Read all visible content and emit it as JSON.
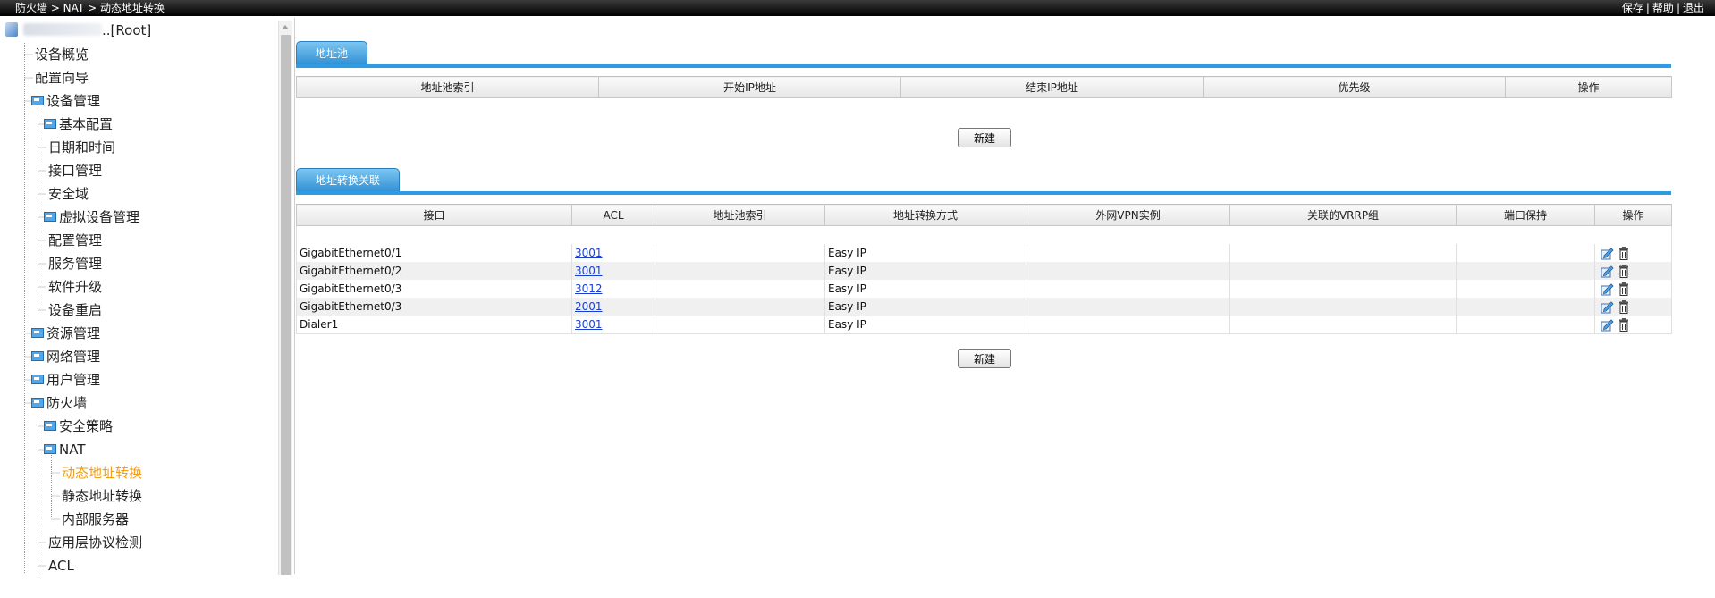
{
  "topbar": {
    "breadcrumb": "防火墙 > NAT > 动态地址转换",
    "save": "保存",
    "sep1": "|",
    "help": "帮助",
    "sep2": "|",
    "logout": "退出"
  },
  "sidebar": {
    "root_label": "..[Root]",
    "items": [
      {
        "label": "设备概览"
      },
      {
        "label": "配置向导"
      },
      {
        "label": "设备管理"
      },
      {
        "label": "基本配置"
      },
      {
        "label": "日期和时间"
      },
      {
        "label": "接口管理"
      },
      {
        "label": "安全域"
      },
      {
        "label": "虚拟设备管理"
      },
      {
        "label": "配置管理"
      },
      {
        "label": "服务管理"
      },
      {
        "label": "软件升级"
      },
      {
        "label": "设备重启"
      },
      {
        "label": "资源管理"
      },
      {
        "label": "网络管理"
      },
      {
        "label": "用户管理"
      },
      {
        "label": "防火墙"
      },
      {
        "label": "安全策略"
      },
      {
        "label": "NAT"
      },
      {
        "label": "动态地址转换"
      },
      {
        "label": "静态地址转换"
      },
      {
        "label": "内部服务器"
      },
      {
        "label": "应用层协议检测"
      },
      {
        "label": "ACL"
      }
    ]
  },
  "pool": {
    "tab": "地址池",
    "columns": [
      "地址池索引",
      "开始IP地址",
      "结束IP地址",
      "优先级",
      "操作"
    ],
    "new_button": "新建"
  },
  "nat": {
    "tab": "地址转换关联",
    "columns": [
      "接口",
      "ACL",
      "地址池索引",
      "地址转换方式",
      "外网VPN实例",
      "关联的VRRP组",
      "端口保持",
      "操作"
    ],
    "rows": [
      {
        "iface": "GigabitEthernet0/1",
        "acl": "3001",
        "pool": "",
        "mode": "Easy IP",
        "vpn": "",
        "vrrp": "",
        "port": ""
      },
      {
        "iface": "GigabitEthernet0/2",
        "acl": "3001",
        "pool": "",
        "mode": "Easy IP",
        "vpn": "",
        "vrrp": "",
        "port": ""
      },
      {
        "iface": "GigabitEthernet0/3",
        "acl": "3012",
        "pool": "",
        "mode": "Easy IP",
        "vpn": "",
        "vrrp": "",
        "port": ""
      },
      {
        "iface": "GigabitEthernet0/3",
        "acl": "2001",
        "pool": "",
        "mode": "Easy IP",
        "vpn": "",
        "vrrp": "",
        "port": ""
      },
      {
        "iface": "Dialer1",
        "acl": "3001",
        "pool": "",
        "mode": "Easy IP",
        "vpn": "",
        "vrrp": "",
        "port": ""
      }
    ],
    "new_button": "新建"
  },
  "icons": {
    "edit": "edit-icon",
    "delete": "delete-icon"
  },
  "colors": {
    "tab_blue": "#2f8fd3",
    "active_nav": "#f39c12",
    "link": "#1a3fcf"
  }
}
